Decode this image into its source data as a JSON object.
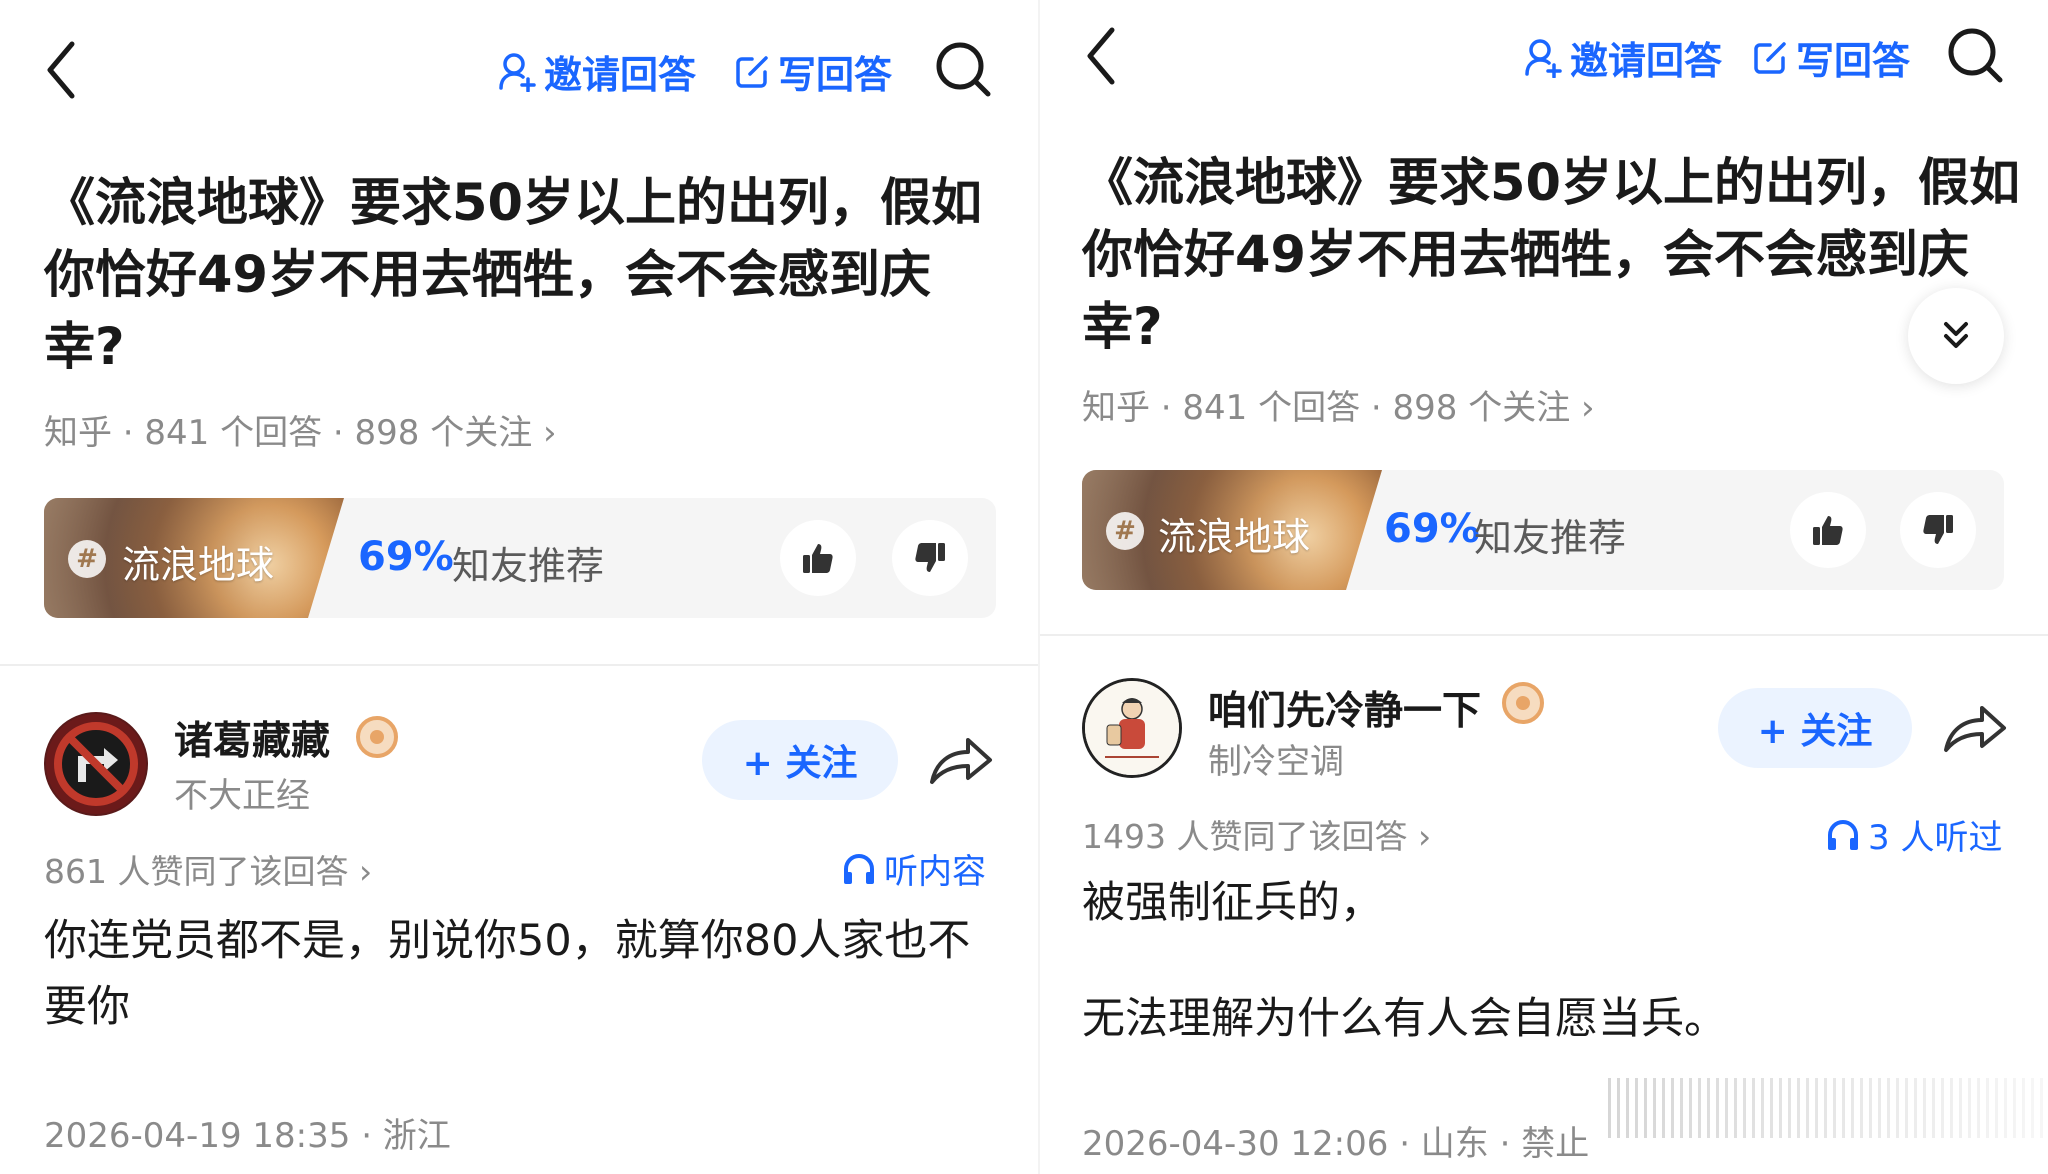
{
  "left": {
    "header": {
      "invite_label": "邀请回答",
      "write_label": "写回答"
    },
    "question": {
      "title": "《流浪地球》要求50岁以上的出列，假如你恰好49岁不用去牺牲，会不会感到庆幸?",
      "meta": "知乎 · 841 个回答 · 898 个关注 ›"
    },
    "topic": {
      "name": "流浪地球",
      "percent": "69%",
      "recommend_label": "知友推荐"
    },
    "answer": {
      "author": "诸葛藏藏",
      "author_desc": "不大正经",
      "follow_label": "+ 关注",
      "likes": "861 人赞同了该回答 ›",
      "listen_label": "听内容",
      "content": "你连党员都不是，别说你50，就算你80人家也不要你",
      "timestamp": "2026-04-19 18:35 · 浙江"
    }
  },
  "right": {
    "header": {
      "invite_label": "邀请回答",
      "write_label": "写回答"
    },
    "question": {
      "title": "《流浪地球》要求50岁以上的出列，假如你恰好49岁不用去牺牲，会不会感到庆幸?",
      "meta": "知乎 · 841 个回答 · 898 个关注 ›"
    },
    "topic": {
      "name": "流浪地球",
      "percent": "69%",
      "recommend_label": "知友推荐"
    },
    "answer": {
      "author": "咱们先冷静一下",
      "author_desc": "制冷空调",
      "follow_label": "+ 关注",
      "likes": "1493 人赞同了该回答 ›",
      "listen_label": "3 人听过",
      "content_line1": "被强制征兵的，",
      "content_line2": "无法理解为什么有人会自愿当兵。",
      "timestamp": "2026-04-30 12:06 · 山东 · 禁止"
    }
  },
  "colors": {
    "accent": "#1a66ff",
    "follow_bg": "#ebf3ff",
    "muted_text": "#8a8a8a",
    "badge": "#e8a567"
  },
  "icons": [
    "back-icon",
    "user-plus-icon",
    "edit-icon",
    "search-icon",
    "hash-icon",
    "thumbs-up-icon",
    "thumbs-down-icon",
    "share-icon",
    "headphones-icon",
    "badge-icon",
    "chevron-double-down-icon"
  ]
}
